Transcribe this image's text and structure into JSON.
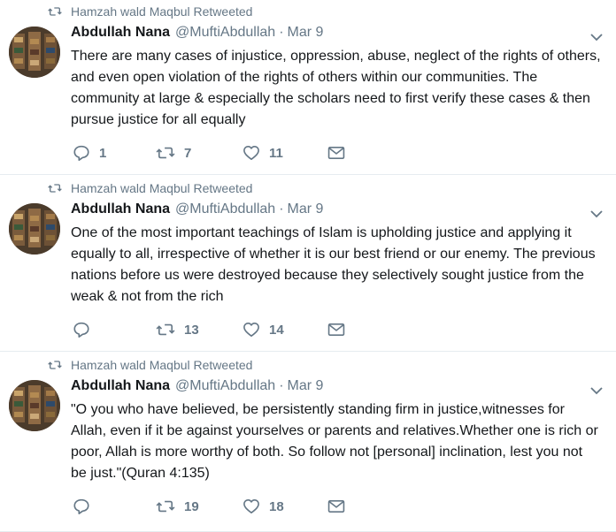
{
  "tweets": [
    {
      "retweeted_by": "Hamzah wald Maqbul Retweeted",
      "name": "Abdullah Nana",
      "handle": "@MuftiAbdullah",
      "dot": "·",
      "date": "Mar 9",
      "text": "There are many cases of injustice, oppression, abuse, neglect of the rights of others, and even open violation of the rights of others within our communities. The community at large & especially the scholars need to first verify these cases & then pursue justice for all equally",
      "replies": "1",
      "retweets": "7",
      "likes": "11"
    },
    {
      "retweeted_by": "Hamzah wald Maqbul Retweeted",
      "name": "Abdullah Nana",
      "handle": "@MuftiAbdullah",
      "dot": "·",
      "date": "Mar 9",
      "text": "One of the most important teachings of Islam is upholding justice and applying it equally to all, irrespective of whether it is our best friend or our enemy.   The previous nations before us were destroyed because they selectively sought justice from the weak & not from the rich",
      "replies": "",
      "retweets": "13",
      "likes": "14"
    },
    {
      "retweeted_by": "Hamzah wald Maqbul Retweeted",
      "name": "Abdullah Nana",
      "handle": "@MuftiAbdullah",
      "dot": "·",
      "date": "Mar 9",
      "text": "\"O you who have believed, be persistently standing firm in justice,witnesses for Allah, even if it be against yourselves or parents and relatives.Whether one is rich or poor, Allah is more worthy of both. So follow not [personal] inclination, lest you not be just.\"(Quran 4:135)",
      "replies": "",
      "retweets": "19",
      "likes": "18"
    }
  ],
  "icons": {
    "retweet": "retweet-icon",
    "reply": "reply-icon",
    "like": "heart-icon",
    "dm": "envelope-icon",
    "caret": "chevron-down-icon"
  },
  "colors": {
    "muted": "#657786",
    "text": "#14171a",
    "divider": "#e6ecf0"
  }
}
